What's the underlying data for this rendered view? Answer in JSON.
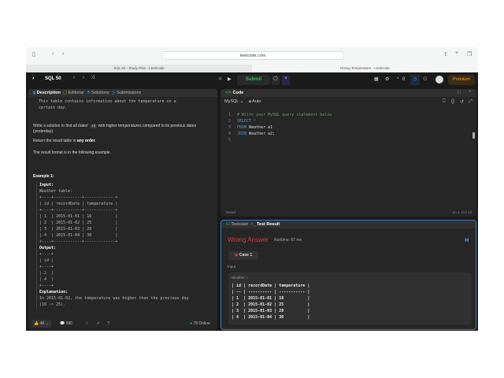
{
  "browser": {
    "url": "leetcode.com",
    "tabs": [
      "SQL 50 - Study Plan - LeetCode",
      "Rising Temperature - LeetCode"
    ]
  },
  "nav": {
    "study_plan": "SQL 50",
    "submit": "Submit",
    "streak": "0",
    "premium": "Premium"
  },
  "left": {
    "tabs": [
      "Description",
      "Editorial",
      "Solutions",
      "Submissions"
    ],
    "intro": "This table contains information about the temperature on a\ncertain day.",
    "q1a": "Write a solution to find all dates'",
    "q1code": "id",
    "q1b": "with higher temperatures compared to its previous dates (yesterday).",
    "q2a": "Return the result table in",
    "q2b": "any order",
    "q2c": ".",
    "q3": "The result format is in the following example.",
    "example": "Example 1:",
    "input_label": "Input:",
    "input_table": "Weather table:\n+----+------------+-------------+\n| id | recordDate | temperature |\n+----+------------+-------------+\n| 1  | 2015-01-01 | 10          |\n| 2  | 2015-01-02 | 25          |\n| 3  | 2015-01-03 | 20          |\n| 4  | 2015-01-04 | 30          |\n+----+------------+-------------+",
    "output_label": "Output:",
    "output_table": "+----+\n| id |\n+----+\n| 2  |\n| 4  |\n+----+",
    "expl_label": "Explanation:",
    "expl": "In 2015-01-02, the temperature was higher than the previous day\n(10 -> 25).",
    "likes": "4K",
    "comments": "586",
    "online": "78 Online"
  },
  "code": {
    "title": "Code",
    "language": "MySQL",
    "mode": "Auto",
    "lines": [
      "# Write your MySQL query statement below",
      "SELECT *",
      "FROM Weather w1",
      "JOIN Weather w2;",
      ""
    ],
    "status": "Saved",
    "cursor": "Ln 4, Col 14"
  },
  "result": {
    "tabs": [
      "Testcase",
      "Test Result"
    ],
    "verdict": "Wrong Answer",
    "runtime": "Runtime: 87 ms",
    "case": "Case 1",
    "input_label": "Input",
    "var": "Weather =",
    "table": "| id | recordDate | temperature |\n| -- | ---------- | ----------- |\n| 1  | 2015-01-01 | 10          |\n| 2  | 2015-01-02 | 25          |\n| 3  | 2015-01-03 | 20          |\n| 4  | 2015-01-04 | 30          |"
  },
  "colors": {
    "accent_green": "#2cbb5d",
    "wrong": "#e0383e",
    "premium": "#ffa116",
    "focus": "#3a78c9"
  }
}
